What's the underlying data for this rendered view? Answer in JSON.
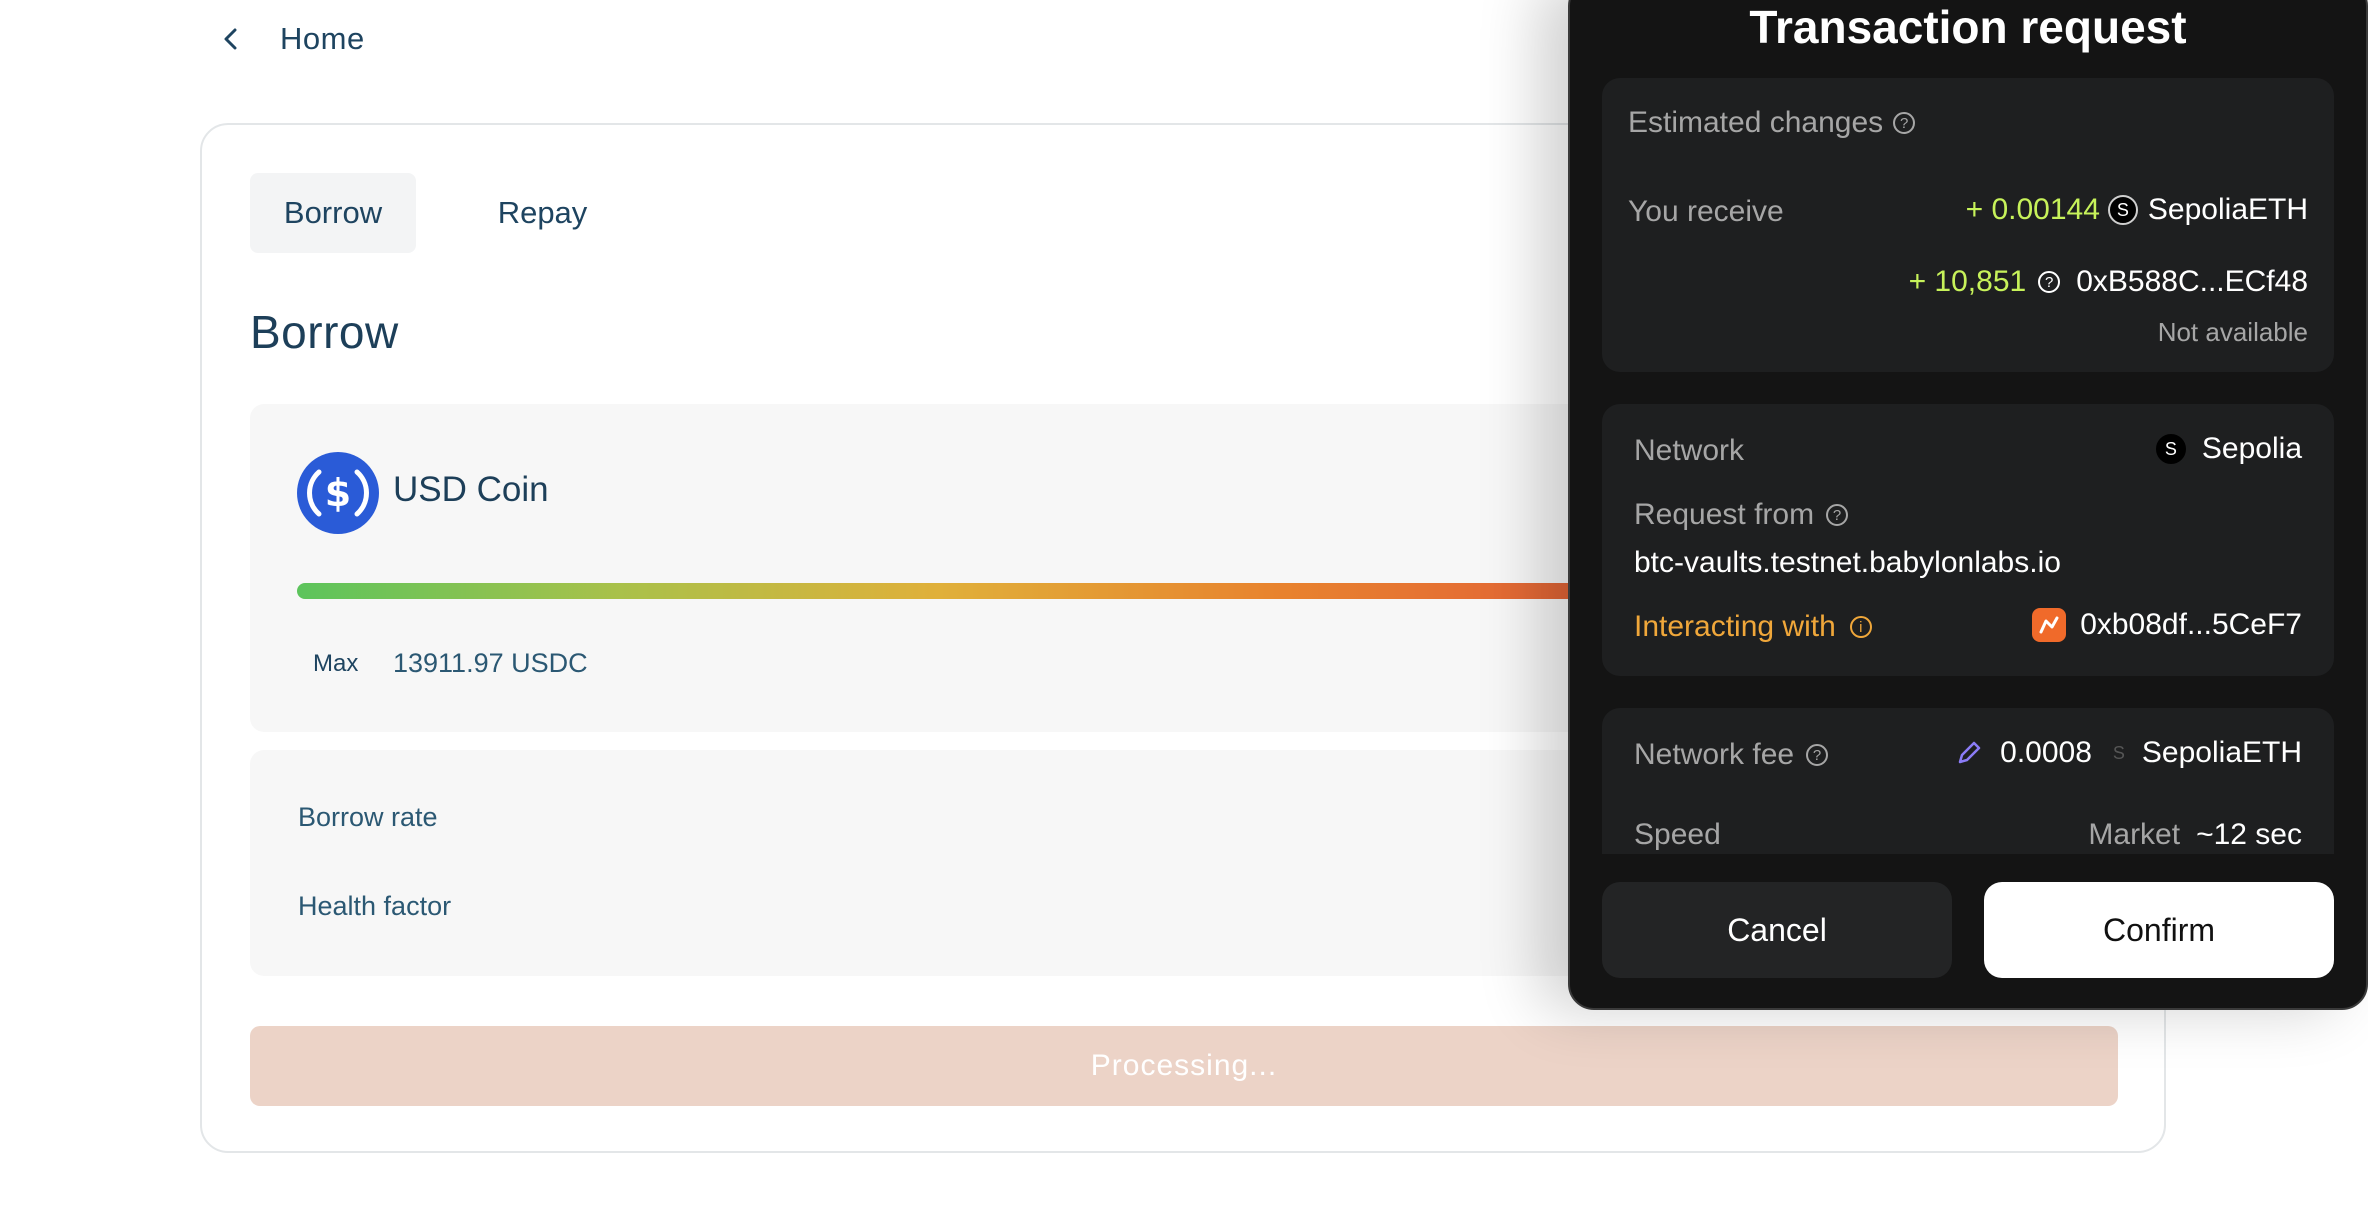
{
  "nav": {
    "back_label": "Home"
  },
  "tabs": [
    {
      "label": "Borrow"
    },
    {
      "label": "Repay"
    }
  ],
  "main": {
    "section_title": "Borrow",
    "asset_name": "USD Coin",
    "max_label": "Max",
    "max_value": "13911.97 USDC",
    "borrow_rate_label": "Borrow rate",
    "health_factor_label": "Health factor",
    "submit_label": "Processing..."
  },
  "popup": {
    "title": "Transaction request",
    "estimated_changes_label": "Estimated changes",
    "you_receive_label": "You receive",
    "receive_amount_1": "+ 0.00144",
    "receive_token_badge": "S",
    "receive_token_1": "SepoliaETH",
    "receive_amount_2": "+ 10,851",
    "receive_token_2": "0xB588C...ECf48",
    "not_available": "Not available",
    "network_label": "Network",
    "network_badge": "S",
    "network_value": "Sepolia",
    "request_from_label": "Request from",
    "request_from_value": "btc-vaults.testnet.babylonlabs.io",
    "interacting_with_label": "Interacting with",
    "interacting_with_value": "0xb08df...5CeF7",
    "network_fee_label": "Network fee",
    "network_fee_value": "0.0008",
    "fee_token_badge": "S",
    "network_fee_token": "SepoliaETH",
    "speed_label": "Speed",
    "speed_mode": "Market",
    "speed_value": "~12 sec",
    "cancel_label": "Cancel",
    "confirm_label": "Confirm"
  },
  "colors": {
    "accent_green": "#c7f25a",
    "accent_orange": "#f0a73a",
    "usdc_blue": "#2775ca",
    "submit_disabled": "#ecd3c7"
  }
}
